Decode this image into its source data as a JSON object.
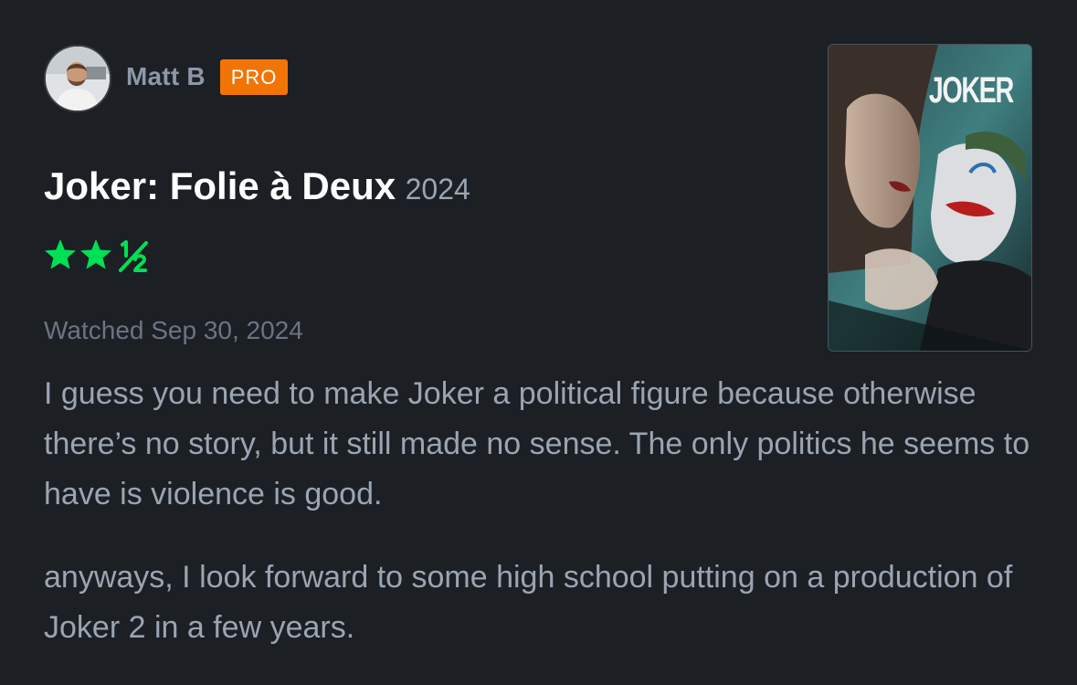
{
  "user": {
    "name": "Matt B",
    "badge": "PRO"
  },
  "film": {
    "title": "Joker: Folie à Deux",
    "year": "2024",
    "poster_title": "JOKER"
  },
  "rating": {
    "value": 2.5,
    "max": 5,
    "color": "#00e054"
  },
  "watched": "Watched Sep 30, 2024",
  "review": {
    "paragraphs": [
      "I guess you need to make Joker a political figure because otherwise there’s no story, but it still made no sense. The only politics he seems to have is violence is good.",
      "anyways, I look forward to some high school putting on a production of Joker 2 in a few years."
    ]
  },
  "colors": {
    "background": "#1c1f24",
    "pro_badge": "#f27405",
    "title": "#ffffff",
    "muted_text": "#9aa5b3"
  }
}
